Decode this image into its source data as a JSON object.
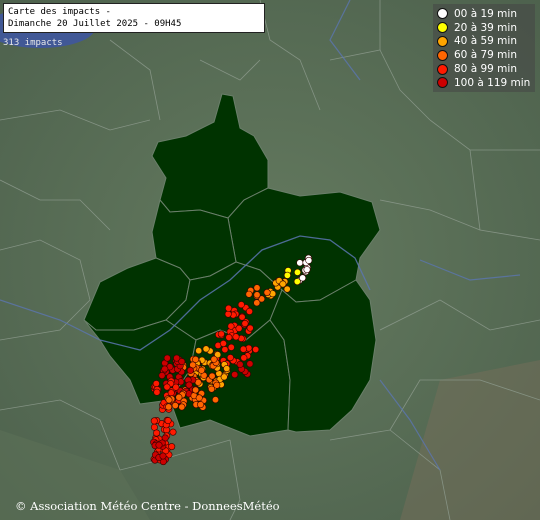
{
  "title": {
    "line1": "Carte des impacts -",
    "line2": "Dimanche 20 Juillet 2025 - 09H45"
  },
  "impact_count": "313 impacts",
  "legend": [
    {
      "label": "00 à 19 min",
      "color": "#ffffff"
    },
    {
      "label": "20 à 39 min",
      "color": "#ffff00"
    },
    {
      "label": "40 à 59 min",
      "color": "#ffa500"
    },
    {
      "label": "60 à 79 min",
      "color": "#ff6600"
    },
    {
      "label": "80 à 99 min",
      "color": "#ff1a00"
    },
    {
      "label": "100 à 119 min",
      "color": "#cc0000"
    }
  ],
  "copyright": "© Association Météo Centre - DonneesMétéo",
  "colors": {
    "background": "#556b55",
    "region_fill": "#003300",
    "region_border": "#6a7f6a"
  }
}
